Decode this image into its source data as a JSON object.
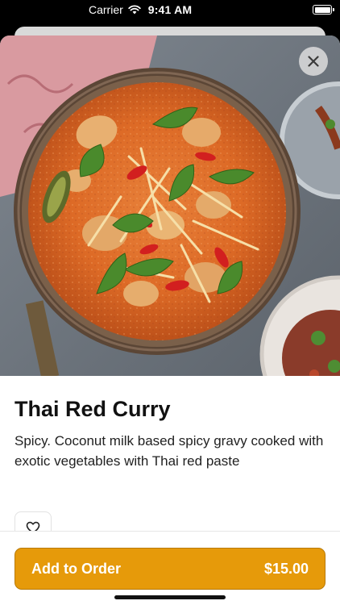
{
  "status_bar": {
    "carrier": "Carrier",
    "time": "9:41 AM"
  },
  "hero_image": {
    "icon": "thai-red-curry-photo",
    "description": "Bowl of Thai red curry with basil, chili and ginger"
  },
  "dish": {
    "title": "Thai Red Curry",
    "description": "Spicy. Coconut milk based spicy gravy cooked with exotic vegetables with Thai red paste"
  },
  "icons": {
    "close": "close-icon",
    "favorite": "heart-icon",
    "wifi": "wifi-icon",
    "battery": "battery-icon"
  },
  "order_button": {
    "label": "Add to Order",
    "price": "$15.00"
  },
  "colors": {
    "accent": "#e69a0a",
    "accent_border": "#b87906",
    "title": "#111111",
    "text": "#222222"
  }
}
